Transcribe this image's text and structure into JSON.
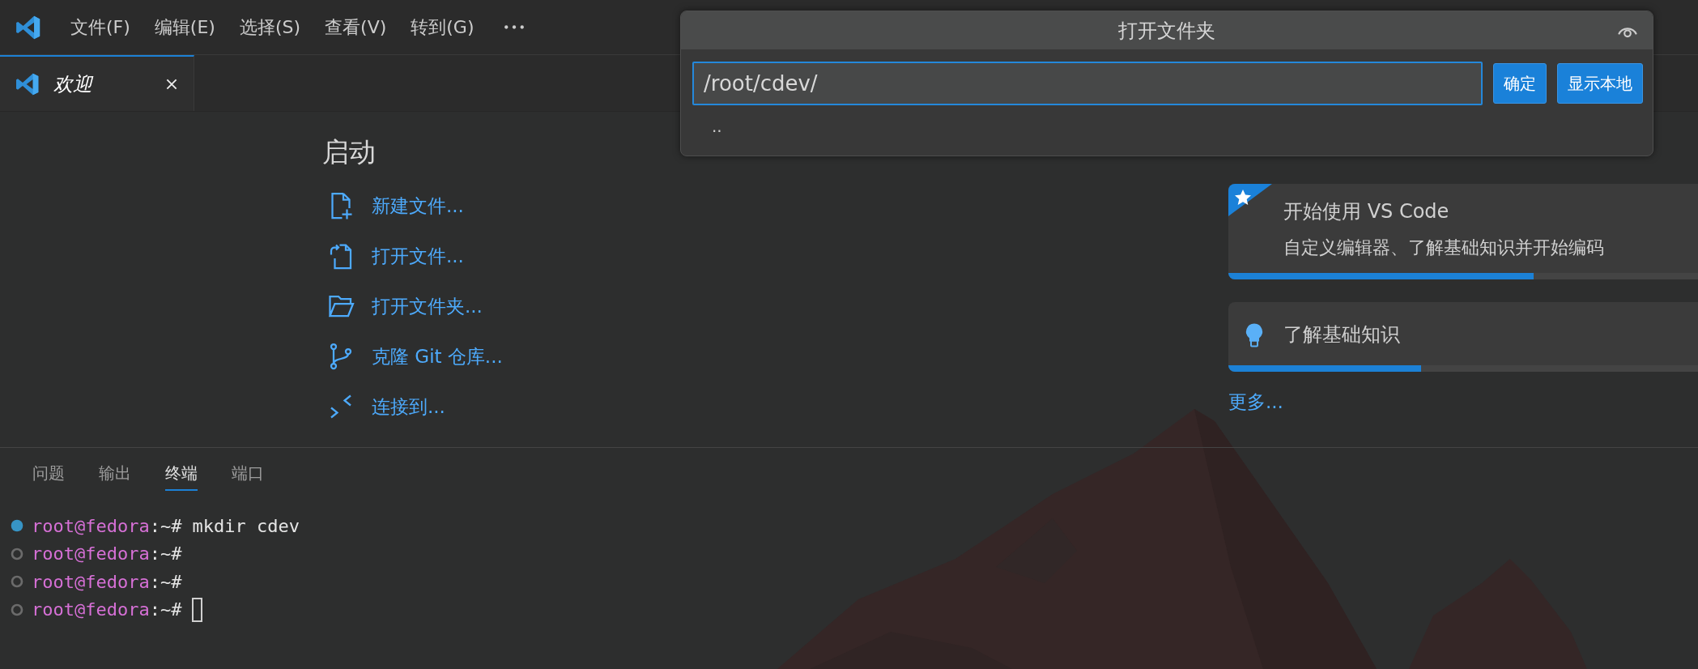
{
  "menu_bar": {
    "items": [
      "文件(F)",
      "编辑(E)",
      "选择(S)",
      "查看(V)",
      "转到(G)"
    ]
  },
  "tabs": [
    {
      "label": "欢迎",
      "selected": true,
      "preview": true
    }
  ],
  "welcome": {
    "start": {
      "title": "启动",
      "items": [
        {
          "label": "新建文件...",
          "kind": "new-file"
        },
        {
          "label": "打开文件...",
          "kind": "open-file"
        },
        {
          "label": "打开文件夹...",
          "kind": "open-folder"
        },
        {
          "label": "克隆 Git 仓库...",
          "kind": "clone"
        },
        {
          "label": "连接到...",
          "kind": "connect"
        }
      ]
    },
    "walkthroughs": {
      "items": [
        {
          "title": "开始使用 VS Code",
          "description": "自定义编辑器、了解基础知识并开始编码",
          "kind": "featured",
          "level": 0.65
        },
        {
          "title": "了解基础知识",
          "kind": "tip",
          "level": 0.41
        }
      ],
      "more": "更多..."
    }
  },
  "panel": {
    "tabs": [
      {
        "label": "问题",
        "selected": false
      },
      {
        "label": "输出",
        "selected": false
      },
      {
        "label": "终端",
        "selected": true
      },
      {
        "label": "端口",
        "selected": false
      }
    ],
    "terminal": {
      "lines": [
        {
          "user": "root@fedora",
          "suffix": ":~#",
          "command": "mkdir cdev",
          "executed": true,
          "cursor": false
        },
        {
          "user": "root@fedora",
          "suffix": ":~#",
          "executed": false,
          "cursor": false
        },
        {
          "user": "root@fedora",
          "suffix": ":~#",
          "executed": false,
          "cursor": false
        },
        {
          "user": "root@fedora",
          "suffix": ":~#",
          "executed": false,
          "cursor": true
        }
      ]
    }
  },
  "dialog": {
    "title": "打开文件夹",
    "input": {
      "value": "/root/cdev/"
    },
    "buttons": [
      "确定",
      "显示本地"
    ],
    "list": [
      ".."
    ]
  }
}
